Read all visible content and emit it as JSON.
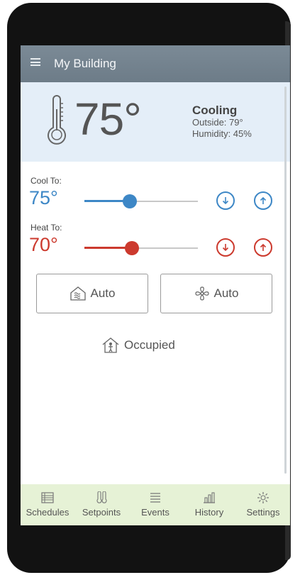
{
  "header": {
    "title": "My Building",
    "menu_icon": "hamburger-menu-icon"
  },
  "status": {
    "temperature": "75°",
    "mode": "Cooling",
    "outside": "Outside: 79°",
    "humidity": "Humidity: 45%",
    "icon": "thermometer-icon"
  },
  "setpoints": {
    "cool": {
      "label": "Cool To:",
      "value": "75°",
      "level": 0.4,
      "color": "#3d87c6"
    },
    "heat": {
      "label": "Heat To:",
      "value": "70°",
      "level": 0.42,
      "color": "#cc3a2e"
    }
  },
  "controls": {
    "system_mode": {
      "label": "Auto",
      "icon": "hvac-mode-icon"
    },
    "fan_mode": {
      "label": "Auto",
      "icon": "fan-icon"
    }
  },
  "occupancy": {
    "label": "Occupied",
    "icon": "house-person-icon"
  },
  "tabs": [
    {
      "label": "Schedules",
      "icon": "schedules-icon"
    },
    {
      "label": "Setpoints",
      "icon": "setpoints-icon"
    },
    {
      "label": "Events",
      "icon": "events-icon"
    },
    {
      "label": "History",
      "icon": "history-icon"
    },
    {
      "label": "Settings",
      "icon": "settings-gear-icon"
    }
  ],
  "colors": {
    "header": "#6d7c88",
    "status_bg": "#e4eef8",
    "tabbar_bg": "#e6f2d6",
    "cool": "#3d87c6",
    "heat": "#cc3a2e"
  }
}
